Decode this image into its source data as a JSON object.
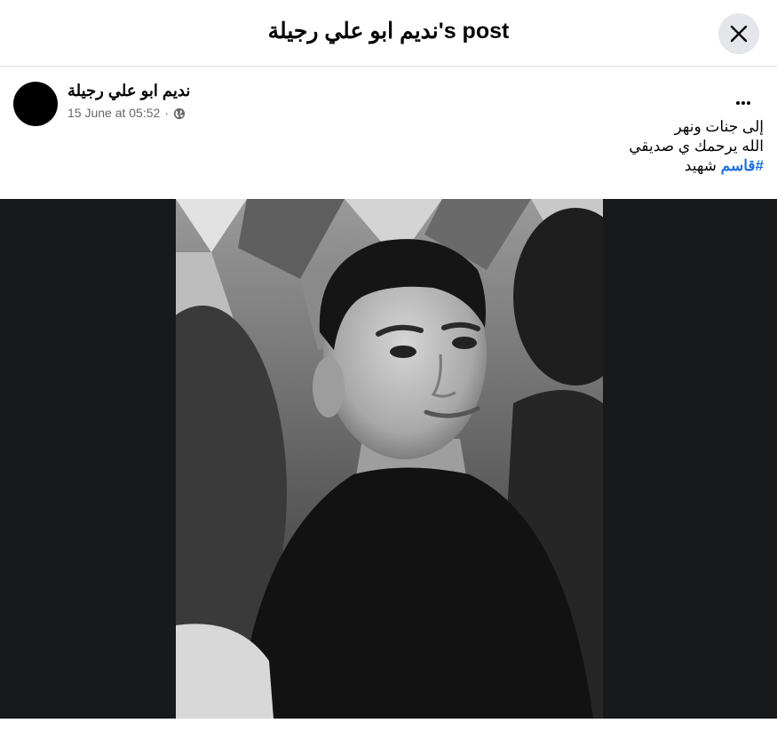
{
  "header": {
    "title": "نديم ابو علي رجيلة's post"
  },
  "post": {
    "author": "نديم ابو علي رجيلة",
    "timestamp": "15 June at 05:52",
    "separator": "·",
    "privacy_icon": "globe-icon",
    "caption_lines": [
      "إلى جنات ونهر",
      "الله يرحمك ي صديقي"
    ],
    "hashtag": "#قاسم",
    "hashtag_suffix": "شهيد"
  },
  "colors": {
    "hashtag": "#216fdb",
    "meta_text": "#65676b",
    "photo_backdrop": "#18191a"
  }
}
